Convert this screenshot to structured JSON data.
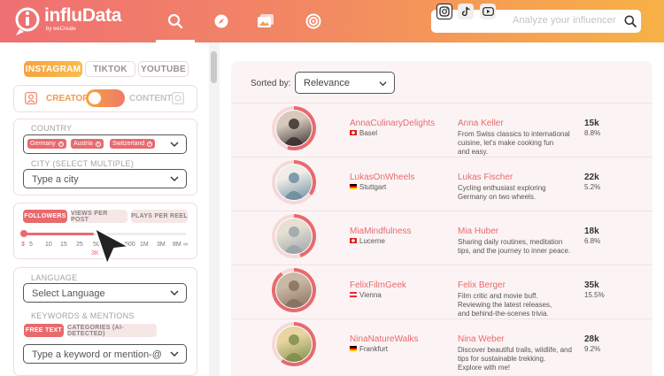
{
  "header": {
    "brand": "influData",
    "brand_sub": "by weCreate",
    "search_placeholder": "Analyze your influencer"
  },
  "platform_tabs": [
    {
      "label": "INSTAGRAM",
      "active": true
    },
    {
      "label": "TIKTOK",
      "active": false
    },
    {
      "label": "YOUTUBE",
      "active": false
    }
  ],
  "toggle": {
    "creator": "CREATOR",
    "content": "CONTENT"
  },
  "country": {
    "label": "COUNTRY",
    "chips": [
      "Germany",
      "Austria",
      "Switzerland"
    ]
  },
  "city": {
    "label": "CITY (SELECT MULTIPLE)",
    "placeholder": "Type a city"
  },
  "metric_tabs": [
    {
      "label": "FOLLOWERS",
      "active": true
    },
    {
      "label": "VIEWS PER POST",
      "active": false
    },
    {
      "label": "PLAYS PER REEL",
      "active": false
    }
  ],
  "slider": {
    "ticks": [
      "3",
      "5",
      "10",
      "15",
      "25",
      "50",
      "100",
      "500",
      "1M",
      "3M",
      "8M",
      "∞"
    ],
    "min_label": "3",
    "selected_label": "3K",
    "fill_fraction": 0.43
  },
  "language": {
    "label": "LANGUAGE",
    "value": "Select Language"
  },
  "keywords": {
    "label": "KEYWORDS & MENTIONS",
    "tabs": [
      {
        "label": "FREE TEXT",
        "active": true
      },
      {
        "label": "CATEGORIES (AI-DETECTED)",
        "active": false
      }
    ],
    "placeholder": "Type a keyword or mention-@"
  },
  "sort": {
    "label": "Sorted by:",
    "value": "Relevance"
  },
  "results": [
    {
      "handle": "AnnaCulinaryDelights",
      "flag": "ch",
      "location": "Basel",
      "name": "Anna Keller",
      "bio": [
        "From Swiss classics to international",
        "cuisine, let's make cooking fun",
        "and easy."
      ],
      "followers": "15k",
      "er": "8.8%",
      "ring": 0.55
    },
    {
      "handle": "LukasOnWheels",
      "flag": "de",
      "location": "Stuttgart",
      "name": "Lukas Fischer",
      "bio": [
        "Cycling enthusiast exploring",
        "Germany on two wheels."
      ],
      "followers": "22k",
      "er": "5.2%",
      "ring": 0.35
    },
    {
      "handle": "MiaMindfulness",
      "flag": "ch",
      "location": "Lucerne",
      "name": "Mia Huber",
      "bio": [
        "Sharing daily routines, meditation",
        "tips, and the journey to inner peace."
      ],
      "followers": "18k",
      "er": "6.8%",
      "ring": 0.45
    },
    {
      "handle": "FelixFilmGeek",
      "flag": "at",
      "location": "Vienna",
      "name": "Felix Berger",
      "bio": [
        "Film critic and movie buff.",
        "Reviewing the latest releases,",
        "and behind-the-scenes trivia."
      ],
      "followers": "35k",
      "er": "15.5%",
      "ring": 0.9
    },
    {
      "handle": "NinaNatureWalks",
      "flag": "de",
      "location": "Frankfurt",
      "name": "Nina Weber",
      "bio": [
        "Discover beautiful trails, wildlife, and",
        "tips for sustainable trekking.",
        "Explore with me!"
      ],
      "followers": "28k",
      "er": "9.2%",
      "ring": 0.6
    }
  ],
  "colors": {
    "accent": "#e86a6f",
    "orange": "#f6a33f"
  }
}
